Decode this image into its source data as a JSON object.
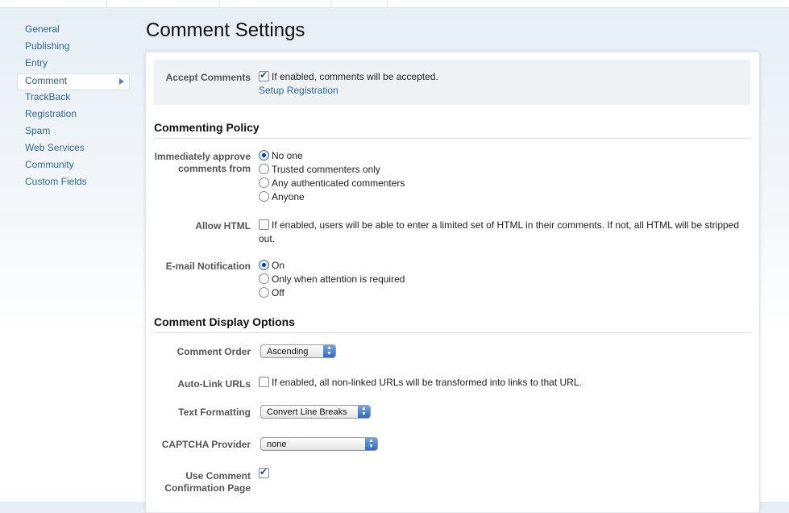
{
  "sidebar": {
    "items": [
      {
        "label": "General"
      },
      {
        "label": "Publishing"
      },
      {
        "label": "Entry"
      },
      {
        "label": "Comment"
      },
      {
        "label": "TrackBack"
      },
      {
        "label": "Registration"
      },
      {
        "label": "Spam"
      },
      {
        "label": "Web Services"
      },
      {
        "label": "Community"
      },
      {
        "label": "Custom Fields"
      }
    ],
    "active": "Comment"
  },
  "page": {
    "title": "Comment Settings"
  },
  "accept_comments": {
    "label": "Accept Comments",
    "checked": true,
    "description": "If enabled, comments will be accepted.",
    "link": "Setup Registration"
  },
  "commenting_policy": {
    "heading": "Commenting Policy",
    "approve": {
      "label_line1": "Immediately approve",
      "label_line2": "comments from",
      "options": [
        "No one",
        "Trusted commenters only",
        "Any authenticated commenters",
        "Anyone"
      ],
      "selected": "No one"
    },
    "allow_html": {
      "label": "Allow HTML",
      "checked": false,
      "description_line1": "If enabled, users will be able to enter a limited set of HTML in their comments. If not, all HTML will be stripped",
      "description_line2": "out."
    },
    "email_notification": {
      "label": "E-mail Notification",
      "options": [
        "On",
        "Only when attention is required",
        "Off"
      ],
      "selected": "On"
    }
  },
  "display_options": {
    "heading": "Comment Display Options",
    "comment_order": {
      "label": "Comment Order",
      "value": "Ascending"
    },
    "auto_link": {
      "label": "Auto-Link URLs",
      "checked": false,
      "description": "If enabled, all non-linked URLs will be transformed into links to that URL."
    },
    "text_formatting": {
      "label": "Text Formatting",
      "value": "Convert Line Breaks"
    },
    "captcha": {
      "label": "CAPTCHA Provider",
      "value": "none"
    },
    "confirmation": {
      "label_line1": "Use Comment",
      "label_line2": "Confirmation Page",
      "checked": true
    }
  },
  "colors": {
    "link": "#2f6a91",
    "selected_radio": "#1d3f72",
    "stepper": "#2c6cc4"
  },
  "icons": {
    "active_arrow": "triangle-right-icon",
    "select_arrows": "updown-arrows-icon"
  }
}
